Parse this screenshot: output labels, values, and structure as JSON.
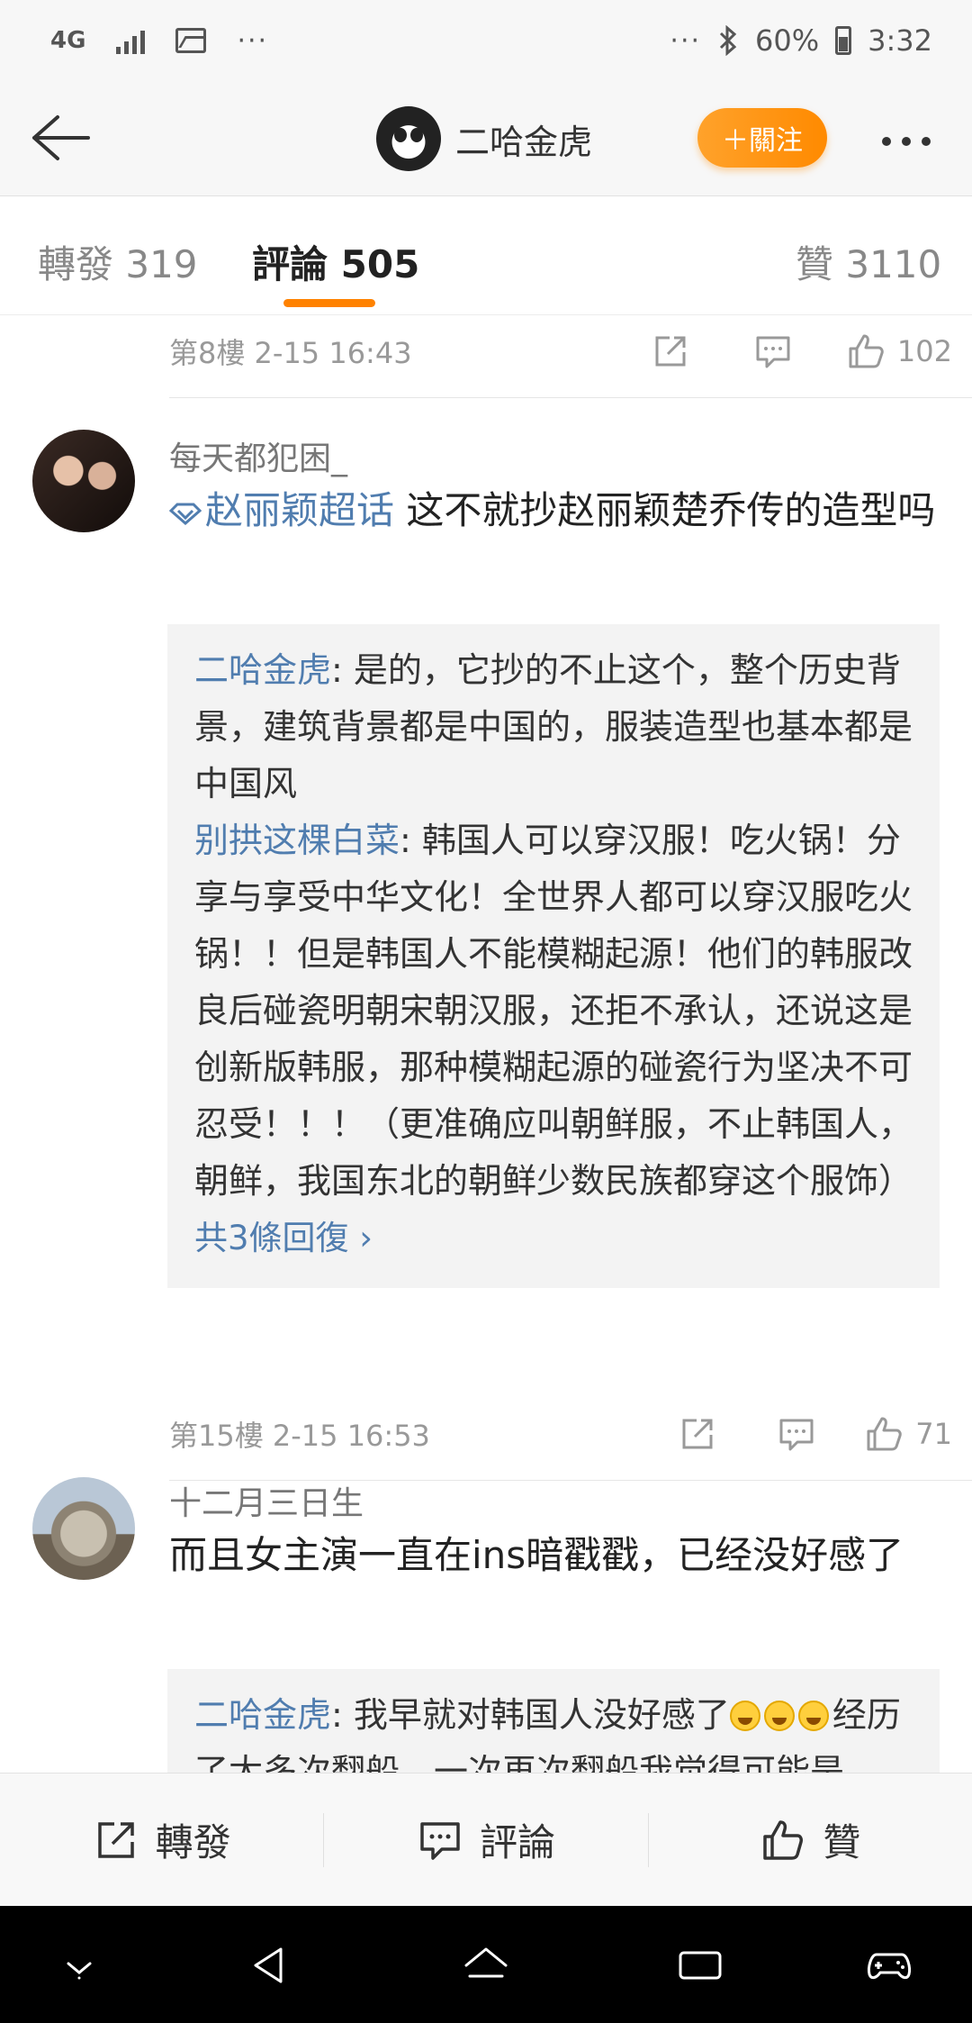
{
  "status_bar": {
    "network": "4G",
    "battery": "60%",
    "time": "3:32",
    "icons": [
      "signal-icon",
      "image-icon",
      "more-dots-icon",
      "bluetooth-icon",
      "battery-icon"
    ]
  },
  "nav": {
    "title": "二哈金虎",
    "follow_label": "＋關注",
    "accent_color": "#ff8200"
  },
  "tabs": {
    "repost": "轉發 319",
    "comment": "評論 505",
    "like": "贊 3110"
  },
  "comments": [
    {
      "floor_time": "第8樓 2-15 16:43",
      "likes": "102"
    },
    {
      "user": "每天都犯困_",
      "topic": "赵丽颖超话",
      "text_after_topic": "  这不就抄赵丽颖楚乔传的造型吗",
      "replies": [
        {
          "name": "二哈金虎",
          "text": ": 是的，它抄的不止这个，整个历史背景，建筑背景都是中国的，服装造型也基本都是中国风"
        },
        {
          "name": "别拱这棵白菜",
          "text": ": 韩国人可以穿汉服！吃火锅！分享与享受中华文化！全世界人都可以穿汉服吃火锅！！但是韩国人不能模糊起源！他们的韩服改良后碰瓷明朝宋朝汉服，还拒不承认，还说这是创新版韩服，那种模糊起源的碰瓷行为坚决不可忍受！！！（更准确应叫朝鲜服，不止韩国人，朝鲜，我国东北的朝鲜少数民族都穿这个服饰）"
        }
      ],
      "more_replies": "共3條回復 ›",
      "floor_time": "第15樓 2-15 16:53",
      "likes": "71"
    },
    {
      "user": "十二月三日生",
      "text": "而且女主演一直在ins暗戳戳，已经没好感了",
      "replies": [
        {
          "name": "二哈金虎",
          "text_before_emoji": ": 我早就对韩国人没好感了",
          "text_after_emoji": "经历了太多次翻船，一次再次翻船我觉得可能是"
        }
      ]
    }
  ],
  "bottom_bar": {
    "repost": "轉發",
    "comment": "評論",
    "like": "贊"
  }
}
